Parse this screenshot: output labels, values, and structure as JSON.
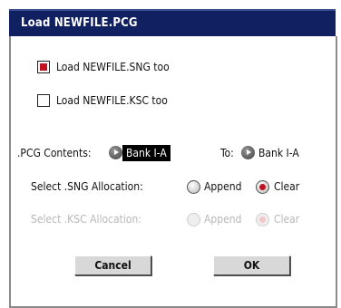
{
  "dialog": {
    "title": "Load NEWFILE.PCG",
    "load_sng": {
      "label": "Load NEWFILE.SNG too",
      "checked": true
    },
    "load_ksc": {
      "label": "Load NEWFILE.KSC too",
      "checked": false
    },
    "pcg_contents": {
      "label": ".PCG Contents:",
      "value": "Bank I-A"
    },
    "to": {
      "label": "To:",
      "value": "Bank I-A"
    },
    "sng_allocation": {
      "label": "Select .SNG Allocation:",
      "options": [
        "Append",
        "Clear"
      ],
      "selected": "Clear"
    },
    "ksc_allocation": {
      "label": "Select .KSC Allocation:",
      "options": [
        "Append",
        "Clear"
      ],
      "selected": "Clear",
      "enabled": false
    },
    "buttons": {
      "cancel": "Cancel",
      "ok": "OK"
    },
    "colors": {
      "title_bar": "#102060",
      "accent": "#c0131f",
      "disabled": "#b8b8b8"
    }
  }
}
